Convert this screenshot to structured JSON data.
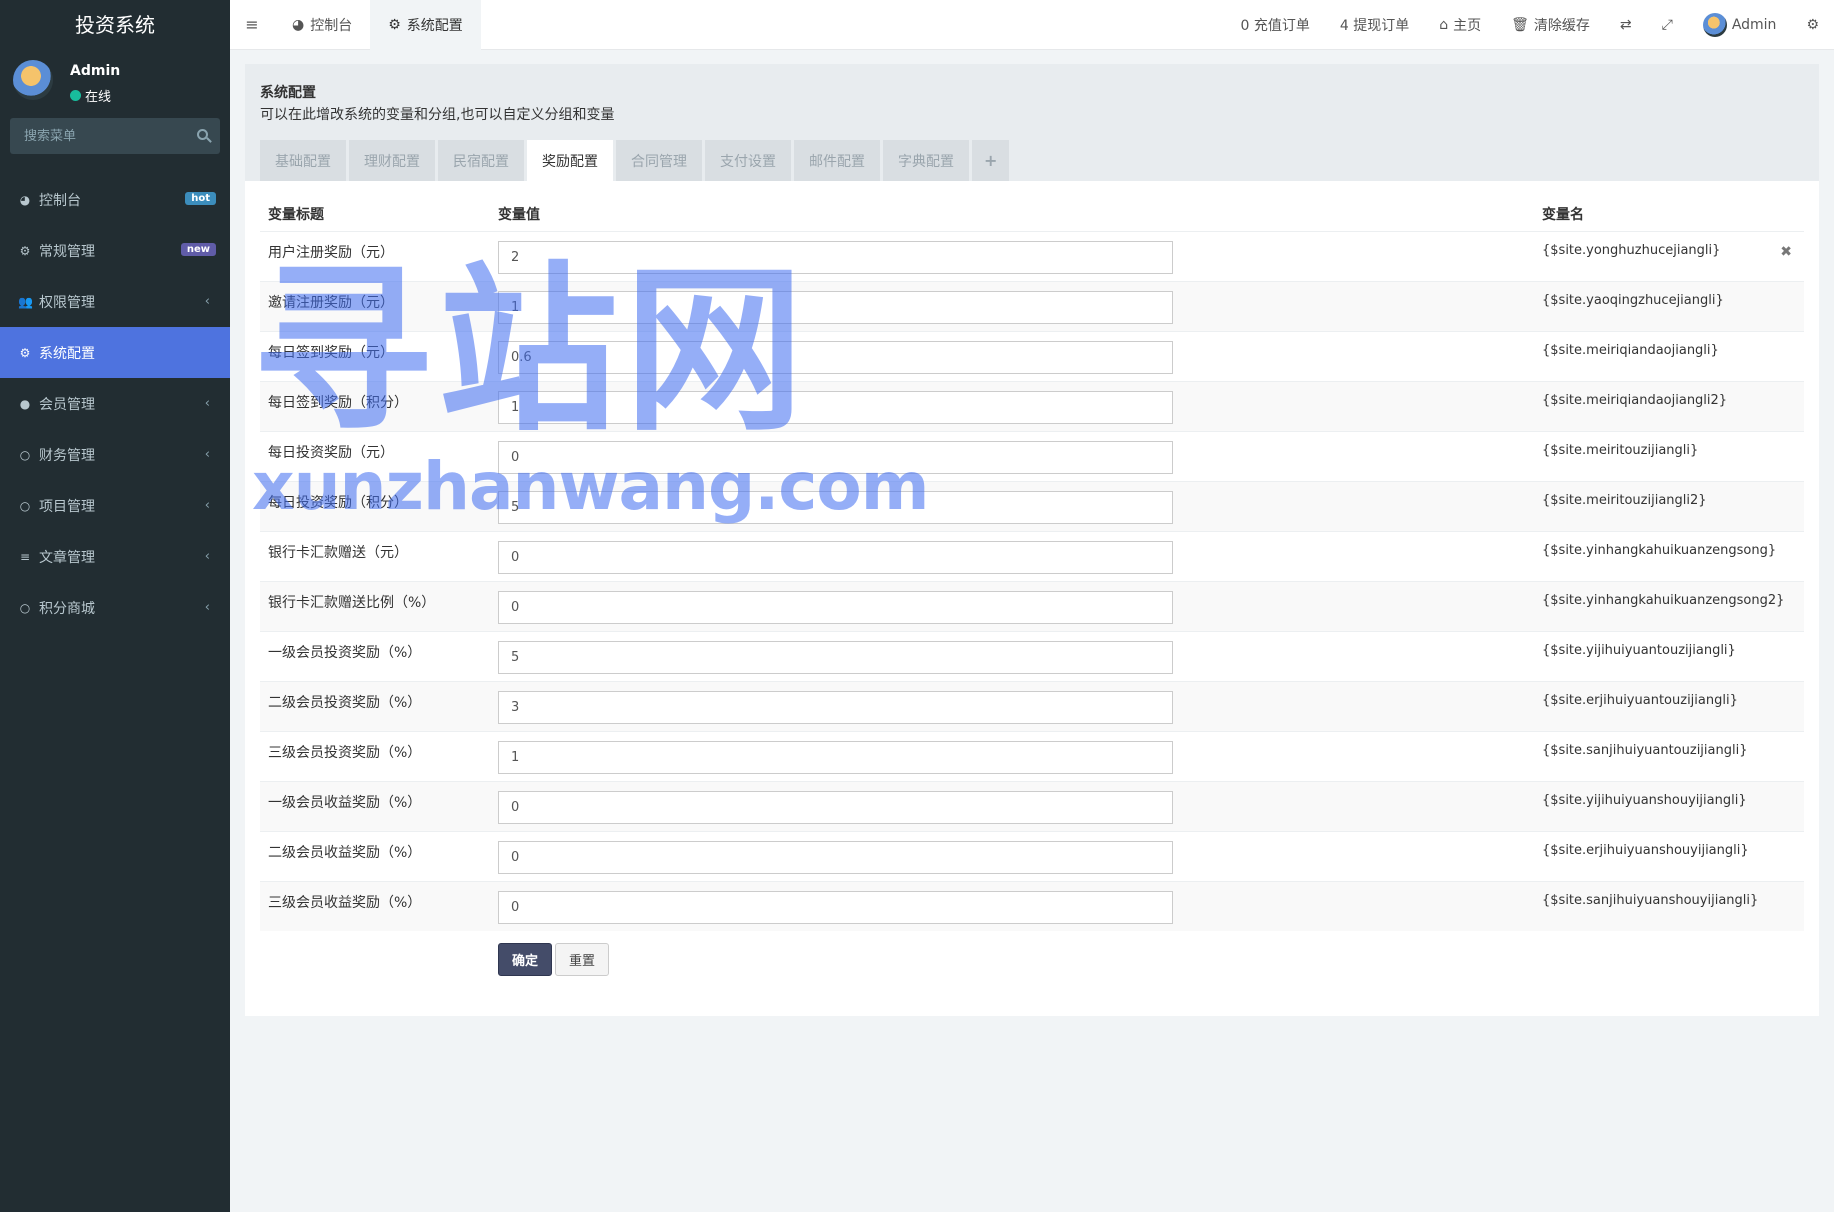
{
  "sidebar": {
    "title": "投资系统",
    "user": {
      "name": "Admin",
      "status": "在线"
    },
    "search_placeholder": "搜索菜单",
    "items": [
      {
        "label": "控制台",
        "icon": "dashboard-icon",
        "badge": "hot"
      },
      {
        "label": "常规管理",
        "icon": "cogs-icon",
        "badge": "new"
      },
      {
        "label": "权限管理",
        "icon": "group-icon"
      },
      {
        "label": "系统配置",
        "icon": "gear-icon",
        "active": true
      },
      {
        "label": "会员管理",
        "icon": "user-circle-icon"
      },
      {
        "label": "财务管理",
        "icon": "circle-icon"
      },
      {
        "label": "项目管理",
        "icon": "circle-icon"
      },
      {
        "label": "文章管理",
        "icon": "list-icon"
      },
      {
        "label": "积分商城",
        "icon": "circle-icon"
      }
    ]
  },
  "navbar": {
    "tabs": [
      {
        "label": "控制台",
        "icon": "dashboard-icon"
      },
      {
        "label": "系统配置",
        "icon": "gear-icon",
        "active": true
      }
    ],
    "recharge_orders": "0 充值订单",
    "withdraw_orders": "4 提现订单",
    "home": "主页",
    "clear_cache": "清除缓存",
    "user": "Admin"
  },
  "page": {
    "title": "系统配置",
    "description": "可以在此增改系统的变量和分组,也可以自定义分组和变量",
    "tabs": [
      "基础配置",
      "理财配置",
      "民宿配置",
      "奖励配置",
      "合同管理",
      "支付设置",
      "邮件配置",
      "字典配置"
    ],
    "active_tab": "奖励配置",
    "add_tab": "+"
  },
  "table": {
    "headers": {
      "title": "变量标题",
      "value": "变量值",
      "name": "变量名"
    },
    "rows": [
      {
        "title": "用户注册奖励（元）",
        "value": "2",
        "name": "{$site.yonghuzhucejiangli}"
      },
      {
        "title": "邀请注册奖励（元）",
        "value": "1",
        "name": "{$site.yaoqingzhucejiangli}"
      },
      {
        "title": "每日签到奖励（元）",
        "value": "0.6",
        "name": "{$site.meiriqiandaojiangli}"
      },
      {
        "title": "每日签到奖励（积分）",
        "value": "1",
        "name": "{$site.meiriqiandaojiangli2}"
      },
      {
        "title": "每日投资奖励（元）",
        "value": "0",
        "name": "{$site.meiritouzijiangli}"
      },
      {
        "title": "每日投资奖励（积分）",
        "value": "5",
        "name": "{$site.meiritouzijiangli2}"
      },
      {
        "title": "银行卡汇款赠送（元）",
        "value": "0",
        "name": "{$site.yinhangkahuikuanzengsong}"
      },
      {
        "title": "银行卡汇款赠送比例（%）",
        "value": "0",
        "name": "{$site.yinhangkahuikuanzengsong2}"
      },
      {
        "title": "一级会员投资奖励（%）",
        "value": "5",
        "name": "{$site.yijihuiyuantouzijiangli}"
      },
      {
        "title": "二级会员投资奖励（%）",
        "value": "3",
        "name": "{$site.erjihuiyuantouzijiangli}"
      },
      {
        "title": "三级会员投资奖励（%）",
        "value": "1",
        "name": "{$site.sanjihuiyuantouzijiangli}"
      },
      {
        "title": "一级会员收益奖励（%）",
        "value": "0",
        "name": "{$site.yijihuiyuanshouyijiangli}"
      },
      {
        "title": "二级会员收益奖励（%）",
        "value": "0",
        "name": "{$site.erjihuiyuanshouyijiangli}"
      },
      {
        "title": "三级会员收益奖励（%）",
        "value": "0",
        "name": "{$site.sanjihuiyuanshouyijiangli}"
      }
    ]
  },
  "buttons": {
    "submit": "确定",
    "reset": "重置"
  },
  "watermark": {
    "cn": "寻站网",
    "en": "xunzhanwang.com"
  },
  "colors": {
    "sidebar_bg": "#222d32",
    "active_menu": "#4e73df",
    "submit_btn": "#444c69",
    "watermark": "#3e6cf0"
  }
}
